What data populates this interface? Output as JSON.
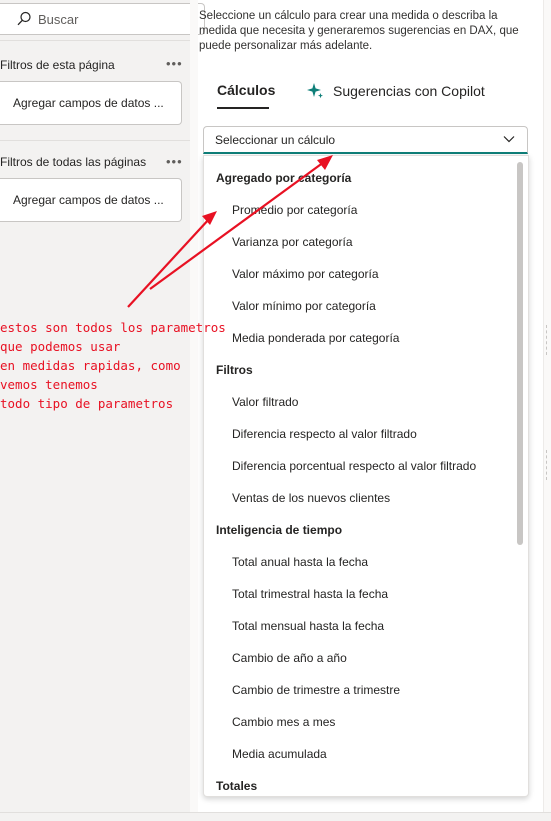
{
  "search": {
    "placeholder": "Buscar"
  },
  "filters": {
    "page_title": "Filtros de esta página",
    "page_drop": "Agregar campos de datos ...",
    "all_title": "Filtros de todas las páginas",
    "all_drop": "Agregar campos de datos ...",
    "more_icon": "more-horizontal-icon"
  },
  "intro_text": "Seleccione un cálculo para crear una medida o describa la medida que necesita y generaremos sugerencias en DAX, que puede personalizar más adelante.",
  "tabs": [
    {
      "label": "Cálculos",
      "active": true
    },
    {
      "label": "Sugerencias con Copilot",
      "icon": "copilot-sparkle-icon"
    }
  ],
  "select": {
    "value": "Seleccionar un cálculo",
    "icon": "chevron-down-icon"
  },
  "dropdown": {
    "groups": [
      {
        "header": "Agregado por categoría",
        "items": [
          "Promedio por categoría",
          "Varianza por categoría",
          "Valor máximo por categoría",
          "Valor mínimo por categoría",
          "Media ponderada por categoría"
        ]
      },
      {
        "header": "Filtros",
        "items": [
          "Valor filtrado",
          "Diferencia respecto al valor filtrado",
          "Diferencia porcentual respecto al valor filtrado",
          "Ventas de los nuevos clientes"
        ]
      },
      {
        "header": "Inteligencia de tiempo",
        "items": [
          "Total anual hasta la fecha",
          "Total trimestral hasta la fecha",
          "Total mensual hasta la fecha",
          "Cambio de año a año",
          "Cambio de trimestre a trimestre",
          "Cambio mes a mes",
          "Media acumulada"
        ]
      },
      {
        "header": "Totales",
        "items": []
      }
    ]
  },
  "annotation": {
    "lines": [
      "estos son todos los parametros",
      "que podemos usar",
      "en medidas rapidas, como",
      "vemos tenemos",
      "todo tipo de parametros"
    ],
    "color": "#e81123"
  },
  "colors": {
    "accent": "#0f7f79",
    "annotation": "#e81123"
  }
}
